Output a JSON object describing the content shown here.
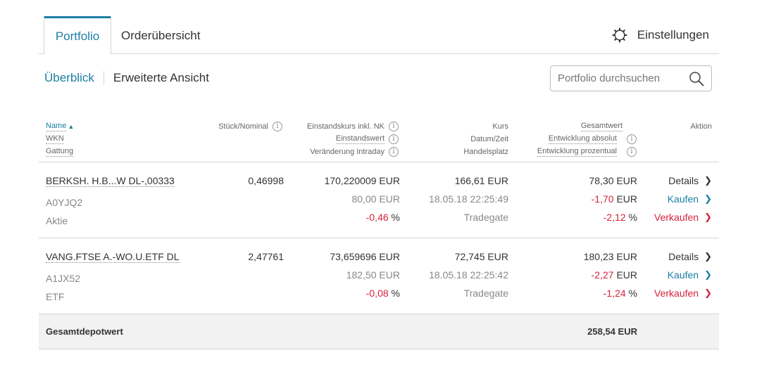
{
  "tabs": {
    "portfolio": "Portfolio",
    "orders": "Orderübersicht",
    "settings": "Einstellungen"
  },
  "subnav": {
    "overview": "Überblick",
    "extended": "Erweiterte Ansicht"
  },
  "search": {
    "placeholder": "Portfolio durchsuchen"
  },
  "columns": {
    "name": "Name",
    "wkn": "WKN",
    "gattung": "Gattung",
    "stueck": "Stück/Nominal",
    "einstandskurs": "Einstandskurs inkl. NK",
    "einstandswert": "Einstandswert",
    "intraday": "Veränderung Intraday",
    "kurs": "Kurs",
    "datum": "Datum/Zeit",
    "handelsplatz": "Handelsplatz",
    "gesamtwert": "Gesamtwert",
    "entw_abs": "Entwicklung absolut",
    "entw_proz": "Entwicklung prozentual",
    "aktion": "Aktion"
  },
  "actions": {
    "details": "Details",
    "kaufen": "Kaufen",
    "verkaufen": "Verkaufen"
  },
  "rows": [
    {
      "name": "BERKSH. H.B...W DL-,00333",
      "wkn": "A0YJQ2",
      "gattung": "Aktie",
      "stueck": "0,46998",
      "einstandskurs": "170,220009 EUR",
      "einstandswert": "80,00 EUR",
      "intraday_val": "-0,46",
      "kurs": "166,61 EUR",
      "datum": "18.05.18 22:25:49",
      "handelsplatz": "Tradegate",
      "gesamtwert": "78,30 EUR",
      "entw_abs": "-1,70",
      "entw_abs_unit": "EUR",
      "entw_proz": "-2,12",
      "pct": "%"
    },
    {
      "name": "VANG.FTSE A.-WO.U.ETF DL",
      "wkn": "A1JX52",
      "gattung": "ETF",
      "stueck": "2,47761",
      "einstandskurs": "73,659696 EUR",
      "einstandswert": "182,50 EUR",
      "intraday_val": "-0,08",
      "kurs": "72,745 EUR",
      "datum": "18.05.18 22:25:42",
      "handelsplatz": "Tradegate",
      "gesamtwert": "180,23 EUR",
      "entw_abs": "-2,27",
      "entw_abs_unit": "EUR",
      "entw_proz": "-1,24",
      "pct": "%"
    }
  ],
  "total": {
    "label": "Gesamtdepotwert",
    "value": "258,54 EUR"
  },
  "icons": {
    "settings": "gear-icon",
    "search": "search-icon",
    "info": "info-icon",
    "chevron": "chevron-right-icon",
    "sort": "sort-ascending-icon"
  },
  "colors": {
    "accent": "#1a7fa3",
    "negative": "#d5223b"
  }
}
